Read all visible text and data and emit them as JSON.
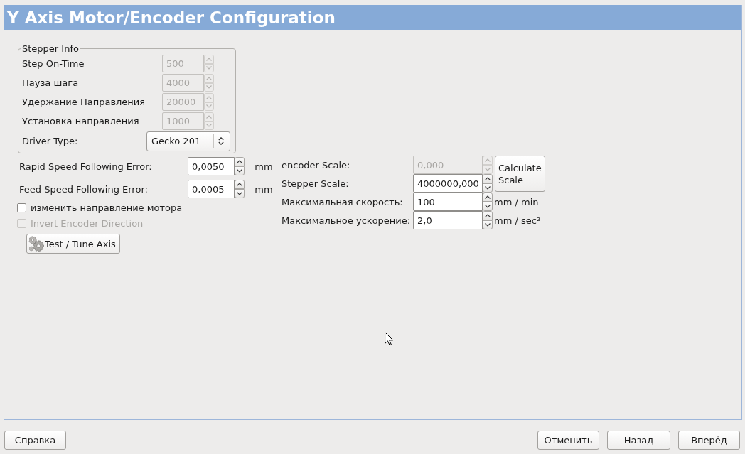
{
  "title": "Y Axis Motor/Encoder Configuration",
  "stepper_info": {
    "title": "Stepper Info",
    "fields": [
      {
        "label": "Step On-Time",
        "value": "500",
        "disabled": true
      },
      {
        "label": "Пауза шага",
        "value": "4000",
        "disabled": true
      },
      {
        "label": "Удержание Направления",
        "value": "20000",
        "disabled": true
      },
      {
        "label": "Установка направления",
        "value": "1000",
        "disabled": true
      }
    ],
    "driver_type": {
      "label": "Driver Type:",
      "value": "Gecko 201"
    }
  },
  "following_errors": [
    {
      "label": "Rapid Speed Following Error:",
      "value": "0,0050",
      "unit": "mm",
      "disabled": false
    },
    {
      "label": "Feed Speed Following Error:",
      "value": "0,0005",
      "unit": "mm",
      "disabled": false
    }
  ],
  "checkboxes": [
    {
      "label": "изменить направление мотора",
      "checked": false,
      "disabled": false
    },
    {
      "label": "Invert Encoder Direction",
      "checked": false,
      "disabled": true
    }
  ],
  "test_button": {
    "label": "Test / Tune Axis"
  },
  "scale_fields": [
    {
      "label": "encoder Scale:",
      "value": "0,000",
      "disabled": true
    },
    {
      "label": "Stepper Scale:",
      "value": "4000000,000",
      "disabled": false
    },
    {
      "label": "Максимальная скорость:",
      "value": "100",
      "unit": "mm / min",
      "disabled": false
    },
    {
      "label": "Максимальное ускорение:",
      "value": "2,0",
      "unit": "mm / sec²",
      "disabled": false
    }
  ],
  "calculate_button": {
    "label": "Calculate Scale"
  },
  "help_button": {
    "label_parts": [
      {
        "text": "С",
        "underlined": true
      },
      {
        "text": "правка",
        "underlined": false
      }
    ]
  },
  "navigation_buttons": [
    {
      "label_parts": [
        {
          "text": "О",
          "underlined": false
        },
        {
          "text": "т",
          "underlined": true
        },
        {
          "text": "менить",
          "underlined": false
        }
      ]
    },
    {
      "label_parts": [
        {
          "text": "На",
          "underlined": false
        },
        {
          "text": "з",
          "underlined": true
        },
        {
          "text": "ад",
          "underlined": false
        }
      ]
    },
    {
      "label_parts": [
        {
          "text": "В",
          "underlined": true
        },
        {
          "text": "перёд",
          "underlined": false
        }
      ]
    }
  ]
}
